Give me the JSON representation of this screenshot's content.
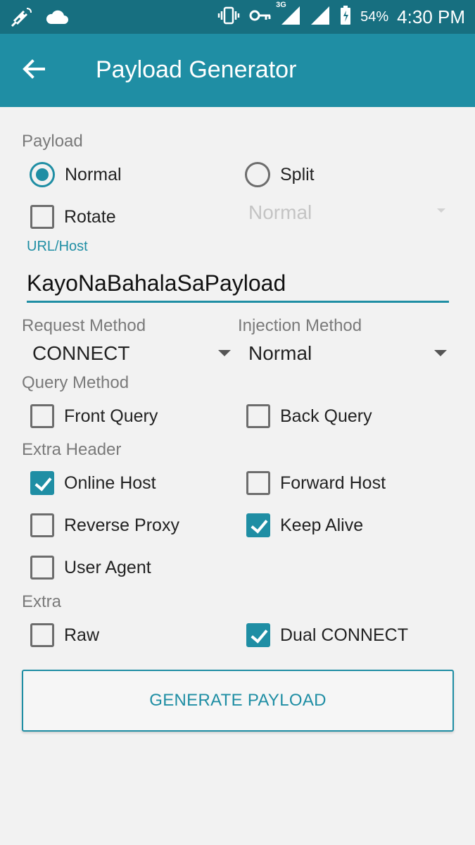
{
  "status": {
    "battery": "54%",
    "time": "4:30 PM",
    "network": "3G"
  },
  "header": {
    "title": "Payload Generator"
  },
  "payload": {
    "label": "Payload",
    "normal_label": "Normal",
    "split_label": "Split",
    "rotate_label": "Rotate",
    "split_value": "Normal",
    "selected": "Normal"
  },
  "url": {
    "label": "URL/Host",
    "value": "KayoNaBahalaSaPayload"
  },
  "request": {
    "label": "Request Method",
    "value": "CONNECT"
  },
  "injection": {
    "label": "Injection Method",
    "value": "Normal"
  },
  "query": {
    "label": "Query Method",
    "front_label": "Front Query",
    "back_label": "Back Query"
  },
  "extra_header": {
    "label": "Extra Header",
    "online_host": "Online Host",
    "forward_host": "Forward Host",
    "reverse_proxy": "Reverse Proxy",
    "keep_alive": "Keep Alive",
    "user_agent": "User Agent"
  },
  "extra": {
    "label": "Extra",
    "raw": "Raw",
    "dual_connect": "Dual CONNECT"
  },
  "button": {
    "label": "GENERATE PAYLOAD"
  },
  "colors": {
    "accent": "#1f8ea4",
    "statusbar": "#176f80",
    "background": "#f2f2f2"
  },
  "checked": {
    "rotate": false,
    "front_query": false,
    "back_query": false,
    "online_host": true,
    "forward_host": false,
    "reverse_proxy": false,
    "keep_alive": true,
    "user_agent": false,
    "raw": false,
    "dual_connect": true
  }
}
